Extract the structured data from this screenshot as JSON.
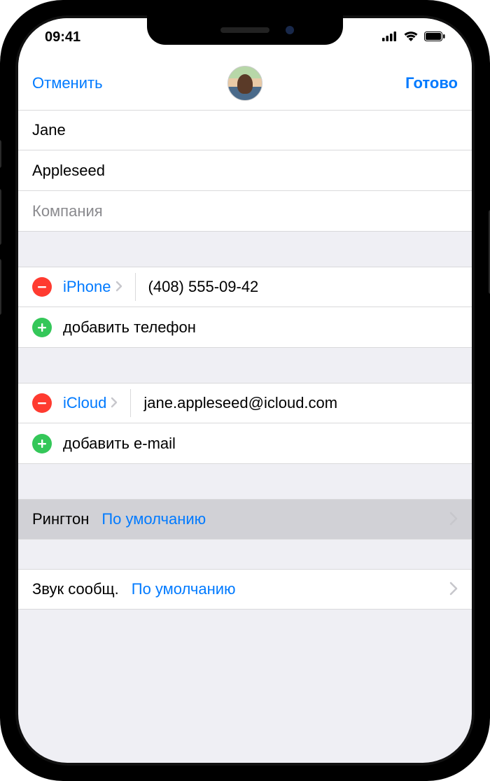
{
  "status": {
    "time": "09:41"
  },
  "nav": {
    "cancel": "Отменить",
    "done": "Готово"
  },
  "name": {
    "first": "Jane",
    "last": "Appleseed",
    "company_placeholder": "Компания"
  },
  "phone": {
    "type": "iPhone",
    "value": "(408) 555-09-42",
    "add_label": "добавить телефон"
  },
  "email": {
    "type": "iCloud",
    "value": "jane.appleseed@icloud.com",
    "add_label": "добавить e-mail"
  },
  "ringtone": {
    "label": "Рингтон",
    "value": "По умолчанию"
  },
  "texttone": {
    "label": "Звук сообщ.",
    "value": "По умолчанию"
  }
}
